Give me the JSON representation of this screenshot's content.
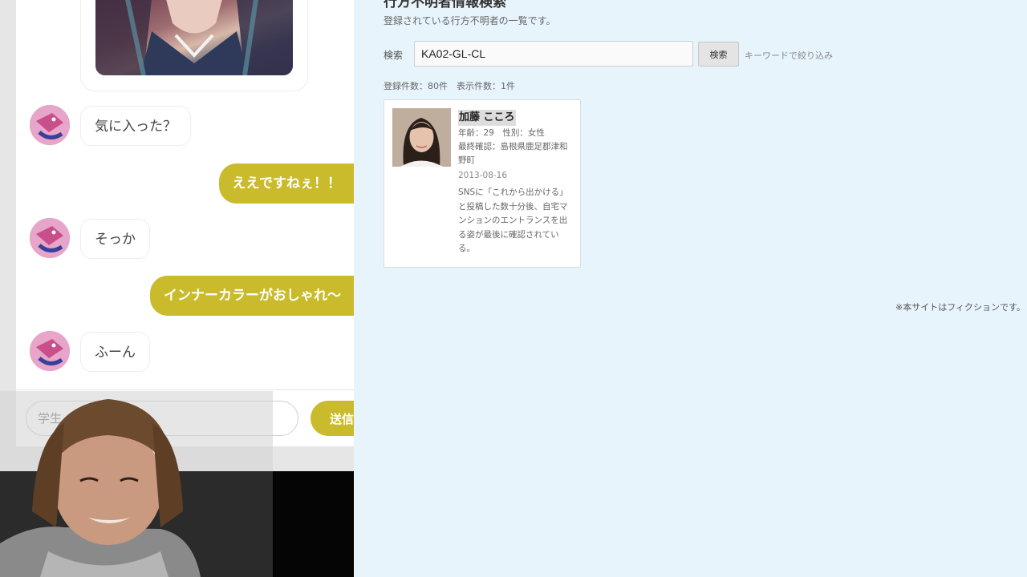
{
  "chat": {
    "messages": [
      {
        "side": "in",
        "text": "気に入った？"
      },
      {
        "side": "out",
        "text": "ええですねぇ！！"
      },
      {
        "side": "in",
        "text": "そっか"
      },
      {
        "side": "out",
        "text": "インナーカラーがおしゃれ〜"
      },
      {
        "side": "in",
        "text": "ふーん"
      }
    ],
    "input_placeholder": "学生",
    "send_label": "送信"
  },
  "search_page": {
    "title": "行方不明者情報検索",
    "description": "登録されている行方不明者の一覧です。",
    "search_label": "検索",
    "search_value": "KA02-GL-CL",
    "search_button": "検索",
    "search_hint": "キーワードで絞り込み",
    "result_count": "登録件数：80件　表示件数：1件",
    "result": {
      "name": "加藤 こころ",
      "age_gender": "年齢：29　性別：女性",
      "last_seen": "最終確認：島根県鹿足郡津和野町",
      "date": "2013-08-16",
      "description": "SNSに「これから出かける」と投稿した数十分後、自宅マンションのエントランスを出る姿が最後に確認されている。"
    },
    "fiction_note": "※本サイトはフィクションです。"
  },
  "colors": {
    "accent_yellow": "#c9bb2b",
    "right_background": "#e8f4fc",
    "avatar_pink": "#d98cb5"
  }
}
